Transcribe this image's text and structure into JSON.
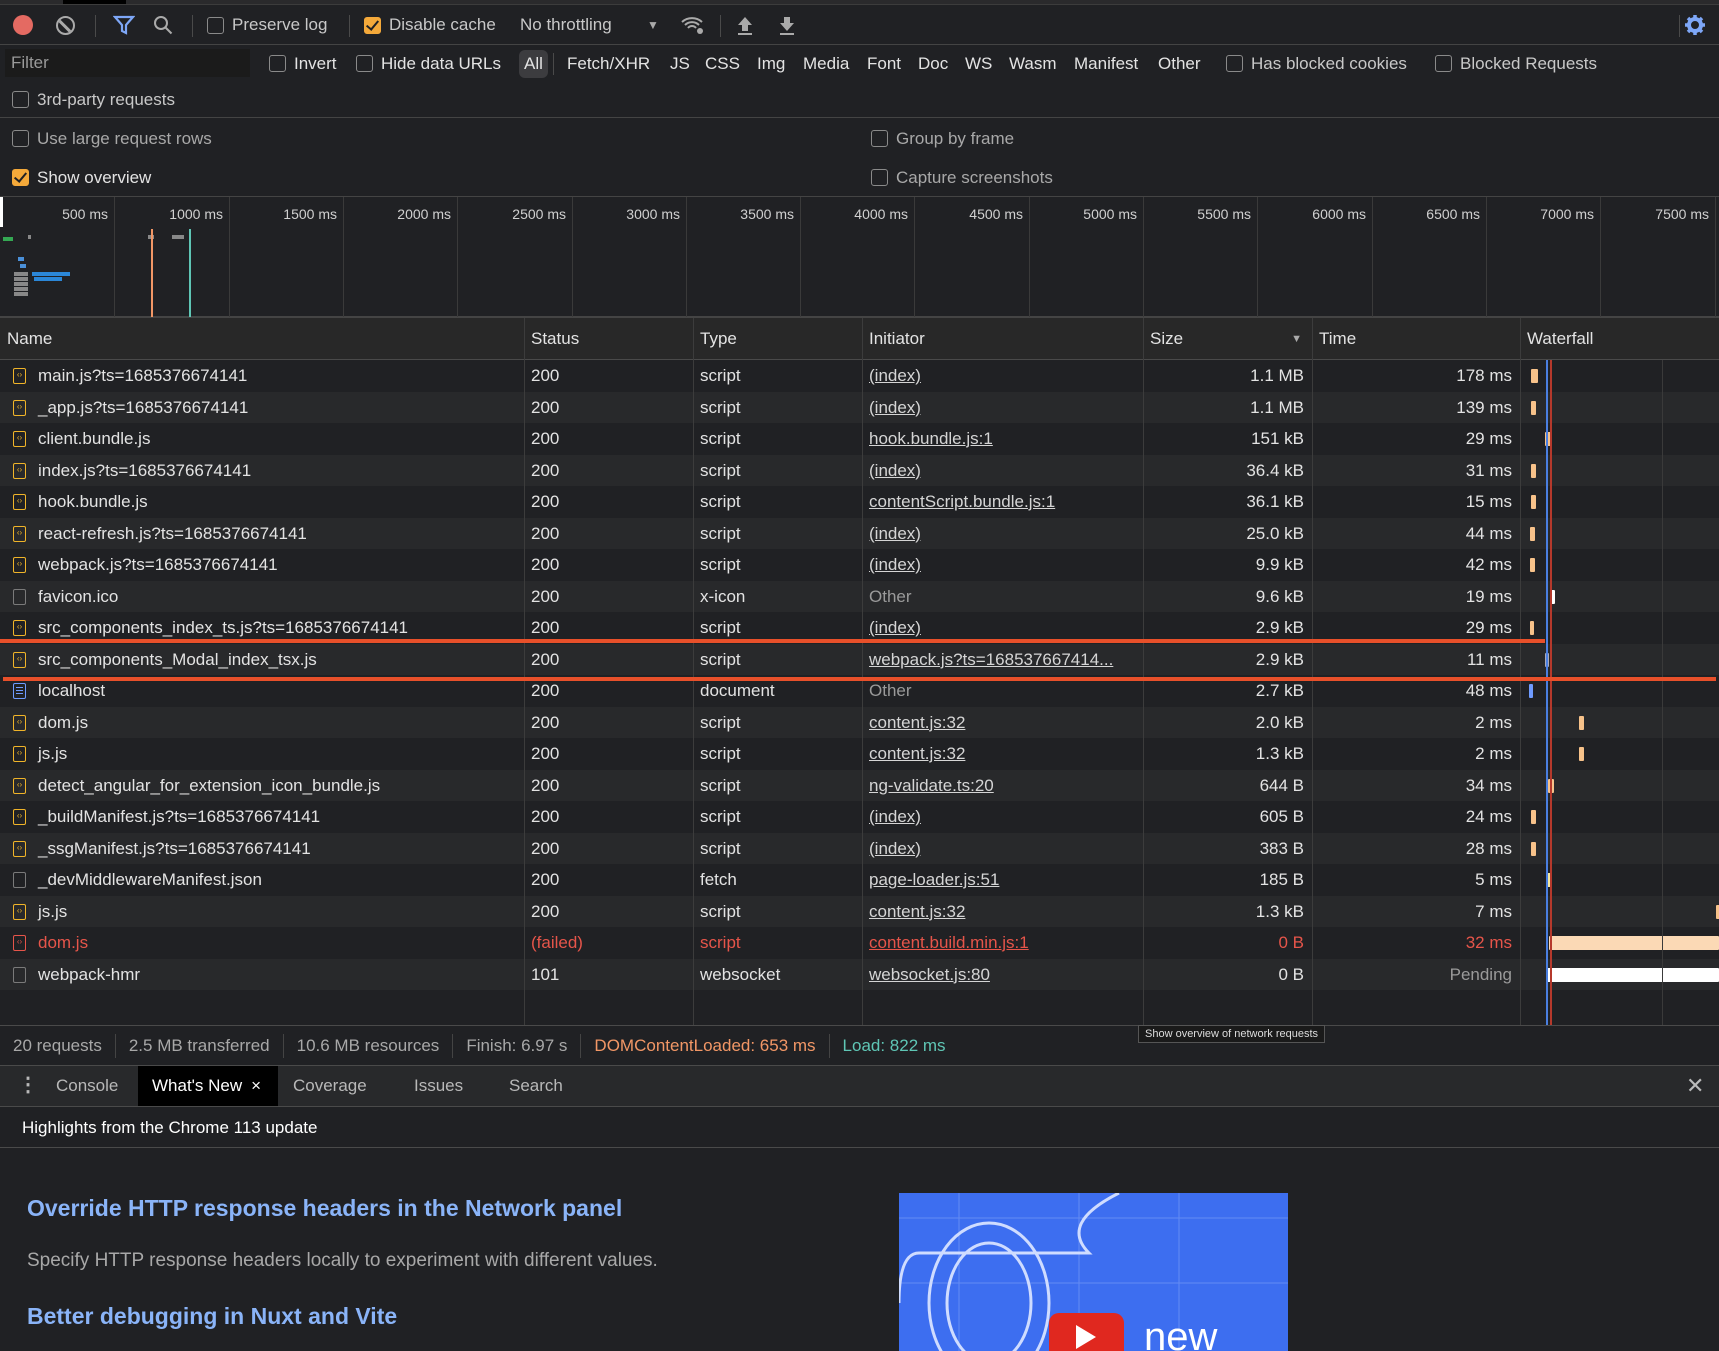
{
  "toolbar": {
    "preserve_log": "Preserve log",
    "preserve_log_checked": false,
    "disable_cache": "Disable cache",
    "disable_cache_checked": true,
    "throttling": "No throttling"
  },
  "filter": {
    "placeholder": "Filter",
    "invert": "Invert",
    "hide_data_urls": "Hide data URLs",
    "types": [
      "All",
      "Fetch/XHR",
      "JS",
      "CSS",
      "Img",
      "Media",
      "Font",
      "Doc",
      "WS",
      "Wasm",
      "Manifest",
      "Other"
    ],
    "active_type": "All",
    "has_blocked_cookies": "Has blocked cookies",
    "blocked_requests": "Blocked Requests",
    "third_party": "3rd-party requests"
  },
  "options": {
    "large_rows": "Use large request rows",
    "group_by_frame": "Group by frame",
    "show_overview": "Show overview",
    "show_overview_checked": true,
    "capture_screenshots": "Capture screenshots"
  },
  "overview": {
    "ticks": [
      "500 ms",
      "1000 ms",
      "1500 ms",
      "2000 ms",
      "2500 ms",
      "3000 ms",
      "3500 ms",
      "4000 ms",
      "4500 ms",
      "5000 ms",
      "5500 ms",
      "6000 ms",
      "6500 ms",
      "7000 ms",
      "7500 ms"
    ]
  },
  "table": {
    "columns": {
      "name": "Name",
      "status": "Status",
      "type": "Type",
      "initiator": "Initiator",
      "size": "Size",
      "time": "Time",
      "waterfall": "Waterfall"
    },
    "sort_column": "Size",
    "sort_direction": "descending",
    "rows": [
      {
        "name": "main.js?ts=1685376674141",
        "status": "200",
        "type": "script",
        "initiator": "(index)",
        "size": "1.1 MB",
        "time": "178 ms",
        "icon": "script-file-icon"
      },
      {
        "name": "_app.js?ts=1685376674141",
        "status": "200",
        "type": "script",
        "initiator": "(index)",
        "size": "1.1 MB",
        "time": "139 ms",
        "icon": "script-file-icon"
      },
      {
        "name": "client.bundle.js",
        "status": "200",
        "type": "script",
        "initiator": "hook.bundle.js:1",
        "size": "151 kB",
        "time": "29 ms",
        "icon": "script-file-icon"
      },
      {
        "name": "index.js?ts=1685376674141",
        "status": "200",
        "type": "script",
        "initiator": "(index)",
        "size": "36.4 kB",
        "time": "31 ms",
        "icon": "script-file-icon"
      },
      {
        "name": "hook.bundle.js",
        "status": "200",
        "type": "script",
        "initiator": "contentScript.bundle.js:1",
        "size": "36.1 kB",
        "time": "15 ms",
        "icon": "script-file-icon"
      },
      {
        "name": "react-refresh.js?ts=1685376674141",
        "status": "200",
        "type": "script",
        "initiator": "(index)",
        "size": "25.0 kB",
        "time": "44 ms",
        "icon": "script-file-icon"
      },
      {
        "name": "webpack.js?ts=1685376674141",
        "status": "200",
        "type": "script",
        "initiator": "(index)",
        "size": "9.9 kB",
        "time": "42 ms",
        "icon": "script-file-icon"
      },
      {
        "name": "favicon.ico",
        "status": "200",
        "type": "x-icon",
        "initiator": "Other",
        "size": "9.6 kB",
        "time": "19 ms",
        "icon": "blank-file-icon"
      },
      {
        "name": "src_components_index_ts.js?ts=1685376674141",
        "status": "200",
        "type": "script",
        "initiator": "(index)",
        "size": "2.9 kB",
        "time": "29 ms",
        "icon": "script-file-icon"
      },
      {
        "name": "src_components_Modal_index_tsx.js",
        "status": "200",
        "type": "script",
        "initiator": "webpack.js?ts=168537667414...",
        "size": "2.9 kB",
        "time": "11 ms",
        "icon": "script-file-icon"
      },
      {
        "name": "localhost",
        "status": "200",
        "type": "document",
        "initiator": "Other",
        "size": "2.7 kB",
        "time": "48 ms",
        "icon": "document-file-icon"
      },
      {
        "name": "dom.js",
        "status": "200",
        "type": "script",
        "initiator": "content.js:32",
        "size": "2.0 kB",
        "time": "2 ms",
        "icon": "script-file-icon"
      },
      {
        "name": "js.js",
        "status": "200",
        "type": "script",
        "initiator": "content.js:32",
        "size": "1.3 kB",
        "time": "2 ms",
        "icon": "script-file-icon"
      },
      {
        "name": "detect_angular_for_extension_icon_bundle.js",
        "status": "200",
        "type": "script",
        "initiator": "ng-validate.ts:20",
        "size": "644 B",
        "time": "34 ms",
        "icon": "script-file-icon"
      },
      {
        "name": "_buildManifest.js?ts=1685376674141",
        "status": "200",
        "type": "script",
        "initiator": "(index)",
        "size": "605 B",
        "time": "24 ms",
        "icon": "script-file-icon"
      },
      {
        "name": "_ssgManifest.js?ts=1685376674141",
        "status": "200",
        "type": "script",
        "initiator": "(index)",
        "size": "383 B",
        "time": "28 ms",
        "icon": "script-file-icon"
      },
      {
        "name": "_devMiddlewareManifest.json",
        "status": "200",
        "type": "fetch",
        "initiator": "page-loader.js:51",
        "size": "185 B",
        "time": "5 ms",
        "icon": "blank-file-icon"
      },
      {
        "name": "js.js",
        "status": "200",
        "type": "script",
        "initiator": "content.js:32",
        "size": "1.3 kB",
        "time": "7 ms",
        "icon": "script-file-icon"
      },
      {
        "name": "dom.js",
        "status": "(failed)",
        "type": "script",
        "initiator": "content.build.min.js:1",
        "size": "0 B",
        "time": "32 ms",
        "icon": "script-file-error-icon",
        "failed": true
      },
      {
        "name": "webpack-hmr",
        "status": "101",
        "type": "websocket",
        "initiator": "websocket.js:80",
        "size": "0 B",
        "time": "Pending",
        "icon": "blank-file-icon"
      }
    ]
  },
  "summary": {
    "requests": "20 requests",
    "transferred": "2.5 MB transferred",
    "resources": "10.6 MB resources",
    "finish": "Finish: 6.97 s",
    "dom_content_loaded": "DOMContentLoaded: 653 ms",
    "load": "Load: 822 ms",
    "dcl_color": "#f29766",
    "load_color": "#5fc6b5"
  },
  "tooltip": "Show overview of network requests",
  "drawer": {
    "tabs": [
      "Console",
      "What's New",
      "Coverage",
      "Issues",
      "Search"
    ],
    "active_tab": "What's New"
  },
  "whats_new": {
    "highlights": "Highlights from the Chrome 113 update",
    "items": [
      {
        "title": "Override HTTP response headers in the Network panel",
        "description": "Specify HTTP response headers locally to experiment with different values."
      },
      {
        "title": "Better debugging in Nuxt and Vite"
      }
    ],
    "video_label": "new"
  },
  "colors": {
    "script_bar": "#f7c28a",
    "doc_bar": "#6f9bff",
    "annotation": "#e8502a",
    "link_heading": "#8ab4f8"
  }
}
